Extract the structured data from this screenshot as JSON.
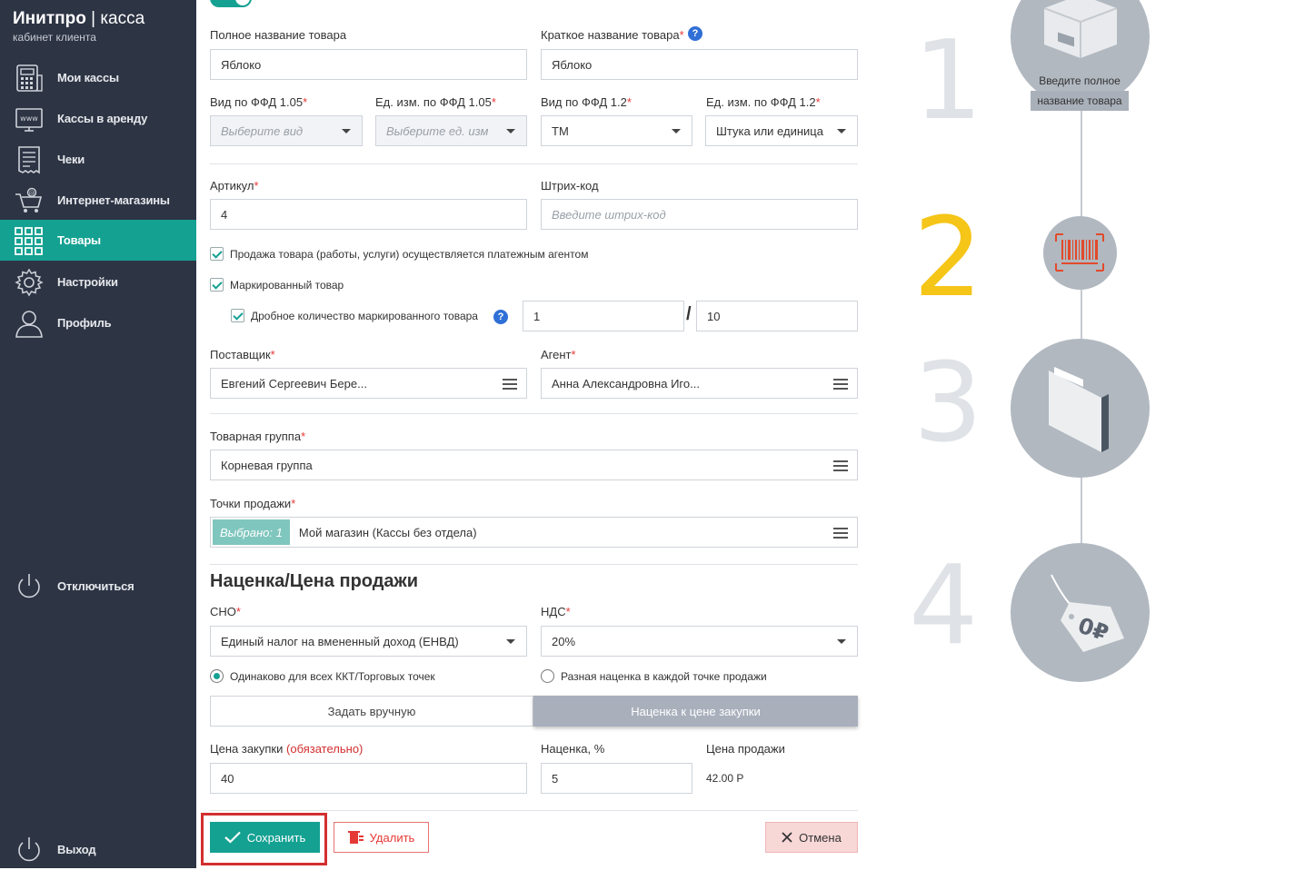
{
  "app": {
    "brand_bold": "Инитпро",
    "brand_sep": "|",
    "brand_thin": "касса",
    "brand_sub": "кабинет клиента"
  },
  "sidebar": {
    "items": [
      {
        "label": "Мои кассы",
        "icon": "cash-register-icon"
      },
      {
        "label": "Кассы в аренду",
        "icon": "www-screen-icon"
      },
      {
        "label": "Чеки",
        "icon": "receipt-icon"
      },
      {
        "label": "Интернет-магазины",
        "icon": "shopping-cart-icon"
      },
      {
        "label": "Товары",
        "icon": "grid-icon",
        "active": true
      },
      {
        "label": "Настройки",
        "icon": "gear-icon"
      },
      {
        "label": "Профиль",
        "icon": "user-icon"
      }
    ],
    "disconnect_label": "Отключиться",
    "logout_label": "Выход"
  },
  "form": {
    "full_name_label": "Полное название товара",
    "full_name_value": "Яблоко",
    "short_name_label": "Краткое название товара",
    "short_name_value": "Яблоко",
    "ffd105_kind_label": "Вид по ФФД 1.05",
    "ffd105_kind_placeholder": "Выберите вид",
    "ffd105_unit_label": "Ед. изм. по ФФД 1.05",
    "ffd105_unit_placeholder": "Выберите ед. изм",
    "ffd12_kind_label": "Вид по ФФД 1.2",
    "ffd12_kind_value": "ТМ",
    "ffd12_unit_label": "Ед. изм. по ФФД 1.2",
    "ffd12_unit_value": "Штука или единица",
    "article_label": "Артикул",
    "article_value": "4",
    "barcode_label": "Штрих-код",
    "barcode_placeholder": "Введите штрих-код",
    "agent_sale_label": "Продажа товара (работы, услуги) осуществляется платежным агентом",
    "marked_label": "Маркированный товар",
    "fractional_label": "Дробное количество маркированного товара",
    "fraction_numerator": "1",
    "fraction_sep": "/",
    "fraction_denominator": "10",
    "supplier_label": "Поставщик",
    "supplier_value": "Евгений Сергеевич Бере...",
    "agent_label": "Агент",
    "agent_value": "Анна Александровна Иго...",
    "group_label": "Товарная группа",
    "group_value": "Корневая группа",
    "points_label": "Точки продажи",
    "points_badge": "Выбрано: 1",
    "points_value": "Мой магазин (Кассы без отдела)",
    "markup_section_title": "Наценка/Цена продажи",
    "sno_label": "СНО",
    "sno_value": "Единый налог на вмененный доход (ЕНВД)",
    "nds_label": "НДС",
    "nds_value": "20%",
    "radio_same_label": "Одинаково для всех ККТ/Торговых точек",
    "radio_diff_label": "Разная наценка в каждой точке продажи",
    "seg_manual_label": "Задать вручную",
    "seg_markup_label": "Наценка к цене закупки",
    "purchase_label": "Цена закупки",
    "purchase_required": "(обязательно)",
    "purchase_value": "40",
    "markup_label": "Наценка, %",
    "markup_value": "5",
    "sale_label": "Цена продажи",
    "sale_value": "42.00 Р",
    "required_mark": "*",
    "help_mark": "?"
  },
  "actions": {
    "save_label": "Сохранить",
    "delete_label": "Удалить",
    "cancel_label": "Отмена"
  },
  "steps": [
    {
      "num": "1",
      "caption_line1": "Введите полное",
      "caption_line2": "название товара",
      "icon": "box-icon"
    },
    {
      "num": "2",
      "icon": "barcode-icon",
      "active": true
    },
    {
      "num": "3",
      "icon": "folder-icon"
    },
    {
      "num": "4",
      "icon": "price-tag-icon"
    }
  ],
  "colors": {
    "sidebar_bg": "#2d3444",
    "accent": "#14a192",
    "step_active": "#f5c518",
    "danger": "#e53935",
    "cancel_bg": "#f8d7d7",
    "highlight_border": "#d32f2f"
  }
}
